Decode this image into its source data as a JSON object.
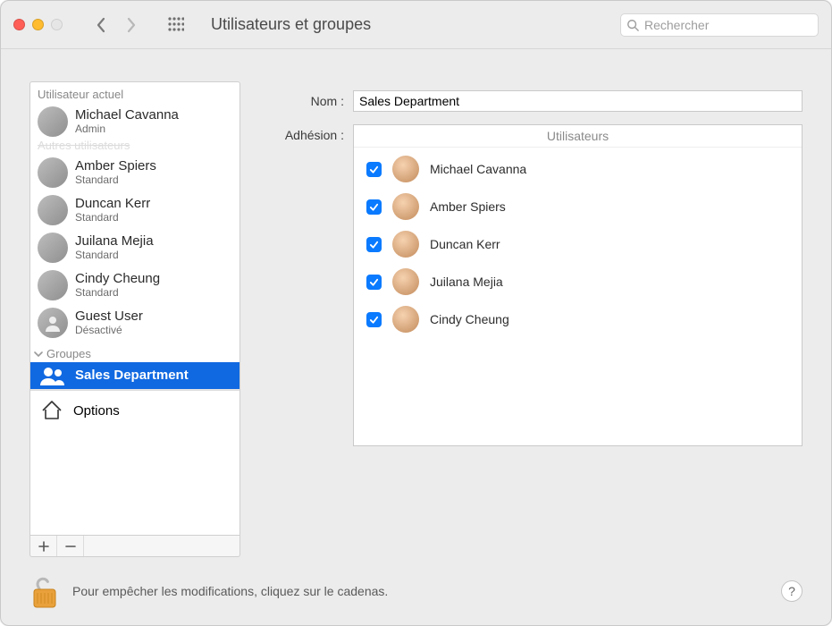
{
  "window": {
    "title": "Utilisateurs et groupes",
    "search_placeholder": "Rechercher"
  },
  "sidebar": {
    "current_user_label": "Utilisateur actuel",
    "other_users_muted": "Autres utilisateurs",
    "groups_label": "Groupes",
    "options_label": "Options",
    "current": {
      "name": "Michael Cavanna",
      "role": "Admin"
    },
    "others": [
      {
        "name": "Amber Spiers",
        "role": "Standard"
      },
      {
        "name": "Duncan Kerr",
        "role": "Standard"
      },
      {
        "name": "Juilana Mejia",
        "role": "Standard"
      },
      {
        "name": "Cindy Cheung",
        "role": "Standard"
      },
      {
        "name": "Guest User",
        "role": "Désactivé"
      }
    ],
    "groups": [
      {
        "name": "Sales Department",
        "selected": true
      }
    ]
  },
  "detail": {
    "name_label": "Nom :",
    "name_value": "Sales Department",
    "members_label": "Adhésion :",
    "members_header": "Utilisateurs",
    "members": [
      {
        "name": "Michael Cavanna",
        "checked": true
      },
      {
        "name": "Amber Spiers",
        "checked": true
      },
      {
        "name": "Duncan Kerr",
        "checked": true
      },
      {
        "name": "Juilana Mejia",
        "checked": true
      },
      {
        "name": "Cindy Cheung",
        "checked": true
      }
    ]
  },
  "footer": {
    "lock_text": "Pour empêcher les modifications, cliquez sur le cadenas.",
    "help_label": "?"
  }
}
